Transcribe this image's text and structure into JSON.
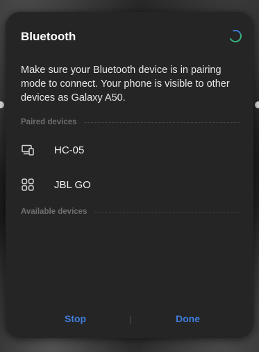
{
  "dialog": {
    "title": "Bluetooth",
    "description": "Make sure your Bluetooth device is in pairing mode to connect. Your phone is visible to other devices as Galaxy A50."
  },
  "paired": {
    "header": "Paired devices",
    "devices": [
      {
        "name": "HC-05",
        "icon": "computer-device-icon"
      },
      {
        "name": "JBL GO",
        "icon": "generic-device-icon"
      }
    ]
  },
  "available": {
    "header": "Available devices"
  },
  "actions": {
    "stop_label": "Stop",
    "done_label": "Done"
  },
  "colors": {
    "accent": "#3f7ddc",
    "dialog_bg": "#252525",
    "spinner_green": "#36b37e"
  }
}
